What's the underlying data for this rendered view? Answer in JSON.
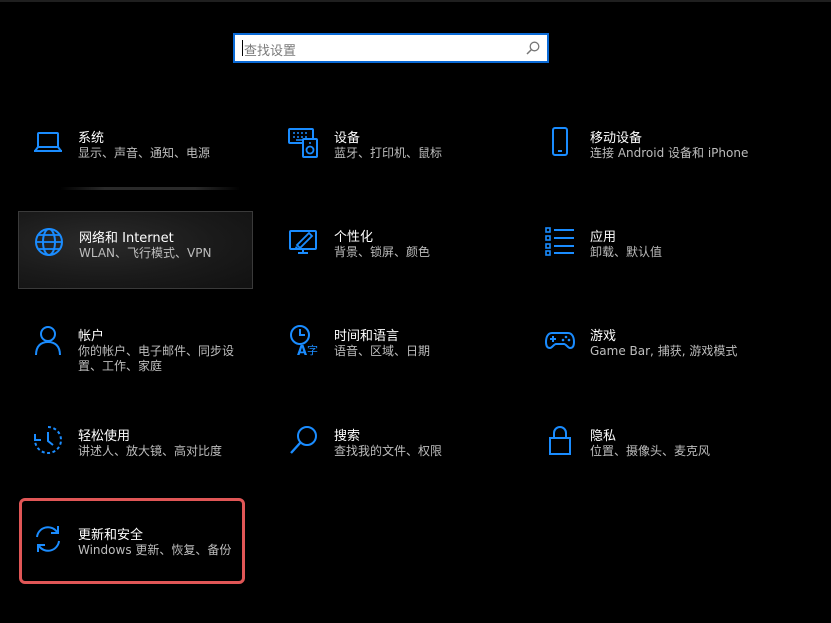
{
  "search": {
    "placeholder": "查找设置"
  },
  "accent_color": "#1a8cff",
  "highlight_color": "#e05656",
  "tiles": [
    {
      "title": "系统",
      "desc": "显示、声音、通知、电源",
      "icon": "laptop-icon"
    },
    {
      "title": "设备",
      "desc": "蓝牙、打印机、鼠标",
      "icon": "devices-icon"
    },
    {
      "title": "移动设备",
      "desc": "连接 Android 设备和 iPhone",
      "icon": "phone-icon"
    },
    {
      "title": "网络和 Internet",
      "desc": "WLAN、飞行模式、VPN",
      "icon": "globe-icon"
    },
    {
      "title": "个性化",
      "desc": "背景、锁屏、颜色",
      "icon": "personalization-icon"
    },
    {
      "title": "应用",
      "desc": "卸载、默认值",
      "icon": "apps-list-icon"
    },
    {
      "title": "帐户",
      "desc": "你的帐户、电子邮件、同步设置、工作、家庭",
      "icon": "person-icon"
    },
    {
      "title": "时间和语言",
      "desc": "语音、区域、日期",
      "icon": "time-language-icon"
    },
    {
      "title": "游戏",
      "desc": "Game Bar, 捕获, 游戏模式",
      "icon": "gamepad-icon"
    },
    {
      "title": "轻松使用",
      "desc": "讲述人、放大镜、高对比度",
      "icon": "ease-of-access-icon"
    },
    {
      "title": "搜索",
      "desc": "查找我的文件、权限",
      "icon": "search-magnifier-icon"
    },
    {
      "title": "隐私",
      "desc": "位置、摄像头、麦克风",
      "icon": "lock-icon"
    },
    {
      "title": "更新和安全",
      "desc": "Windows 更新、恢复、备份",
      "icon": "sync-icon"
    }
  ]
}
